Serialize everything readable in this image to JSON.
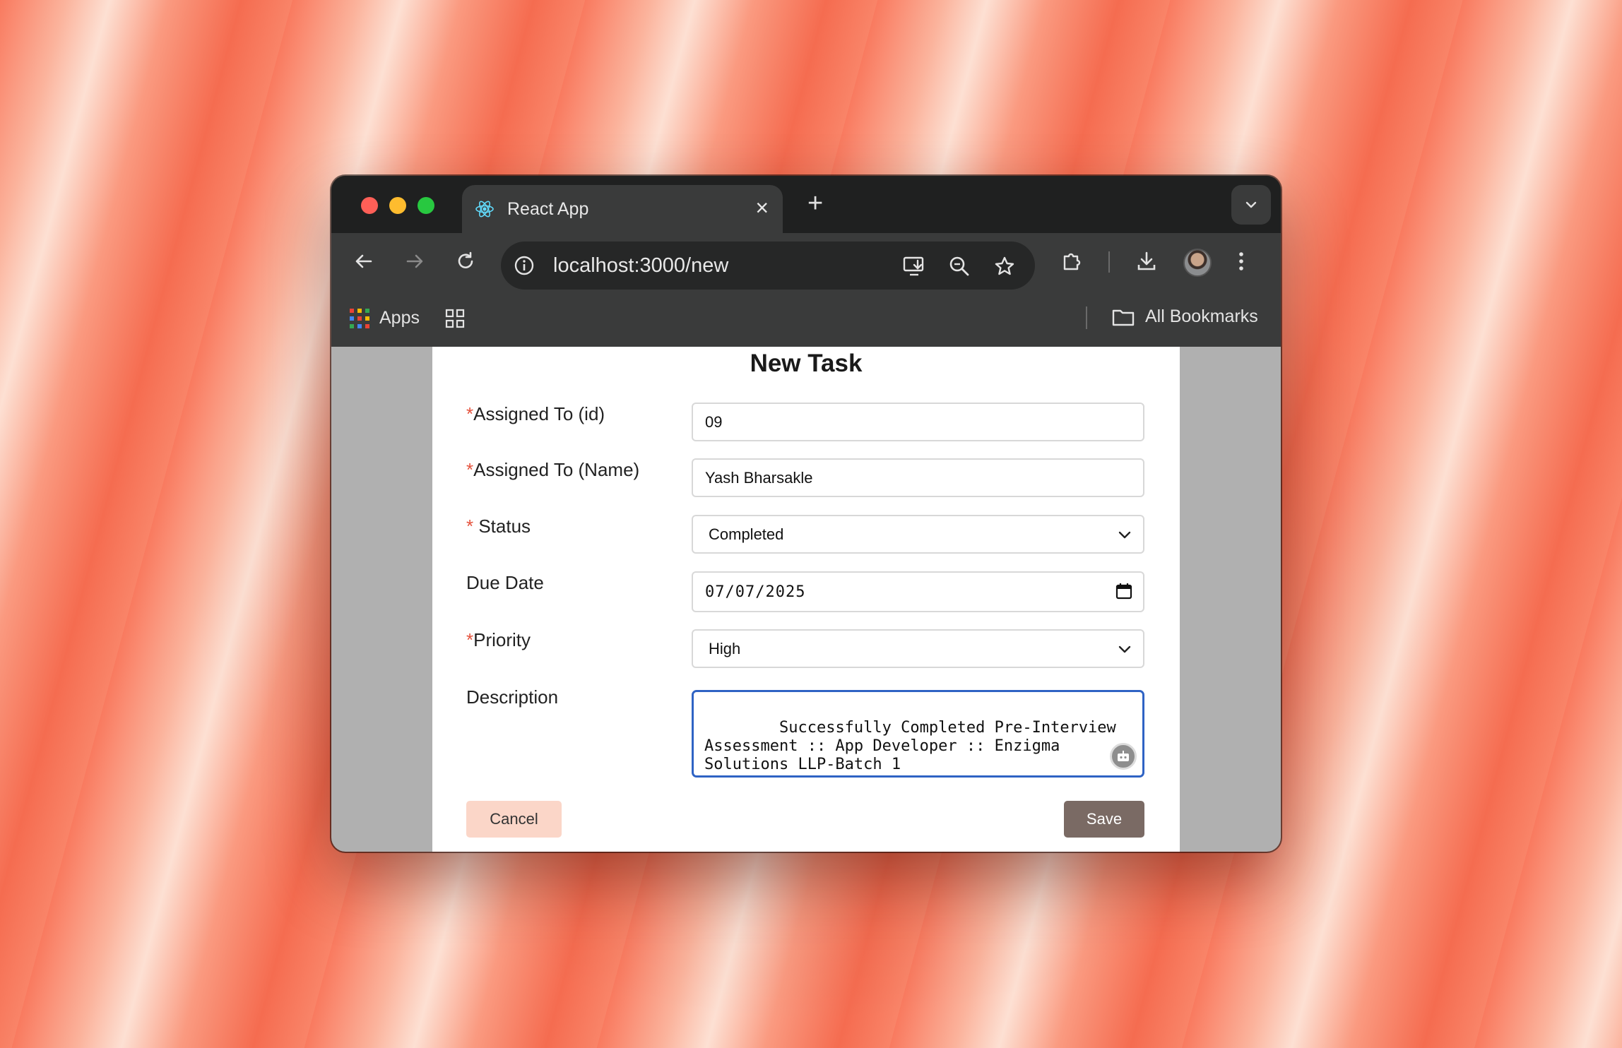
{
  "browser": {
    "tab_title": "React App",
    "url": "localhost:3000/new",
    "bookmarks": {
      "apps_label": "Apps",
      "all_bookmarks_label": "All Bookmarks"
    }
  },
  "form": {
    "title": "New Task",
    "fields": {
      "assigned_id": {
        "required_mark": "*",
        "label": "Assigned To (id)",
        "value": "09"
      },
      "assigned_name": {
        "required_mark": "*",
        "label": "Assigned To (Name)",
        "value": "Yash Bharsakle"
      },
      "status": {
        "required_mark": "* ",
        "label": "Status",
        "value": "Completed"
      },
      "due_date": {
        "label": "Due Date",
        "value": "07/07/2025"
      },
      "priority": {
        "required_mark": "*",
        "label": "Priority",
        "value": "High"
      },
      "description": {
        "label": "Description",
        "value": "Successfully Completed Pre-Interview Assessment :: App Developer :: Enzigma Solutions LLP-Batch 1"
      }
    },
    "buttons": {
      "cancel": "Cancel",
      "save": "Save"
    }
  },
  "colors": {
    "required": "#e5533d",
    "save_button": "#7a6a64",
    "cancel_button": "#fbd6c8",
    "focus_border": "#2f63c4"
  }
}
